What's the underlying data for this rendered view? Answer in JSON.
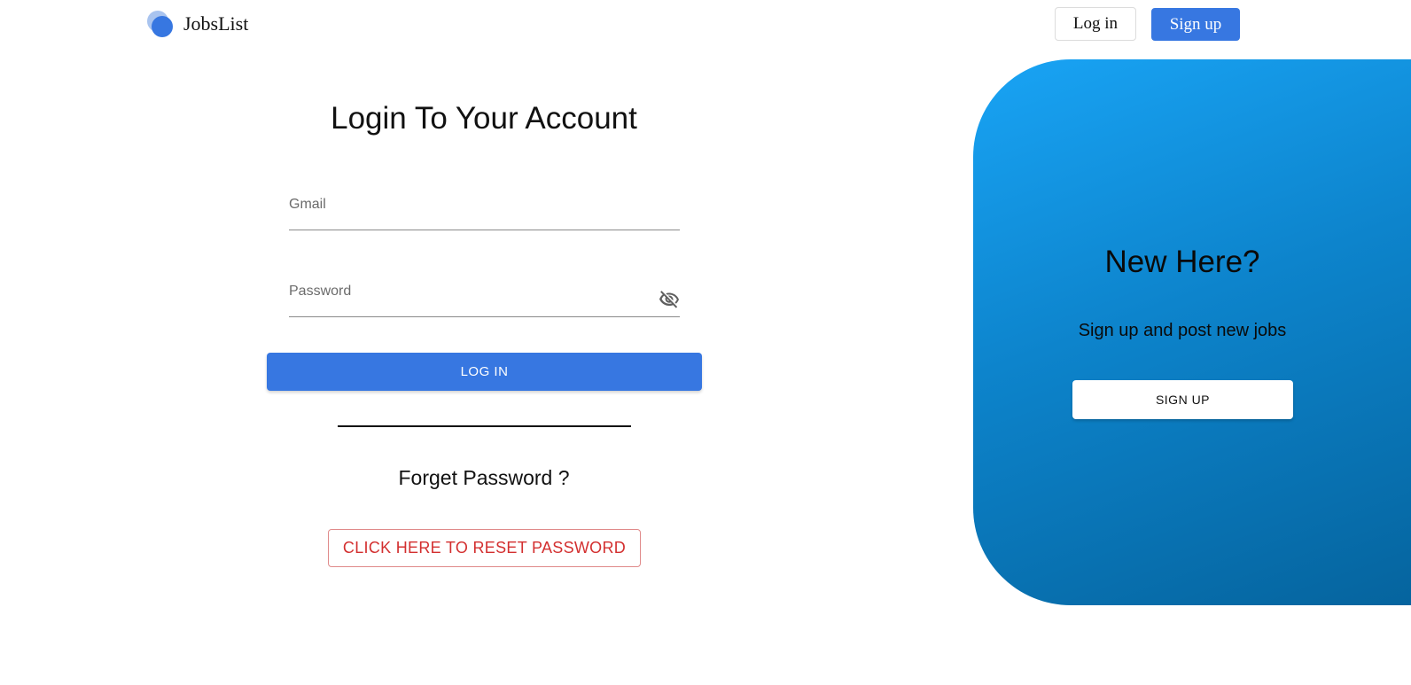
{
  "header": {
    "brand_name": "JobsList",
    "login_label": "Log in",
    "signup_label": "Sign up"
  },
  "login": {
    "title": "Login To Your Account",
    "gmail_placeholder": "Gmail",
    "gmail_value": "",
    "password_placeholder": "Password",
    "password_value": "",
    "password_toggle_icon": "eye-off-icon",
    "submit_label": "LOG IN",
    "forget_text": "Forget Password ?",
    "reset_label": "CLICK HERE TO RESET PASSWORD"
  },
  "panel": {
    "title": "New Here?",
    "subtitle": "Sign up and post new jobs",
    "signup_label": "SIGN UP"
  },
  "colors": {
    "primary": "#3777e1",
    "panel_gradient_start": "#19a4f5",
    "panel_gradient_end": "#05649e",
    "reset_red": "#d32f2f"
  }
}
